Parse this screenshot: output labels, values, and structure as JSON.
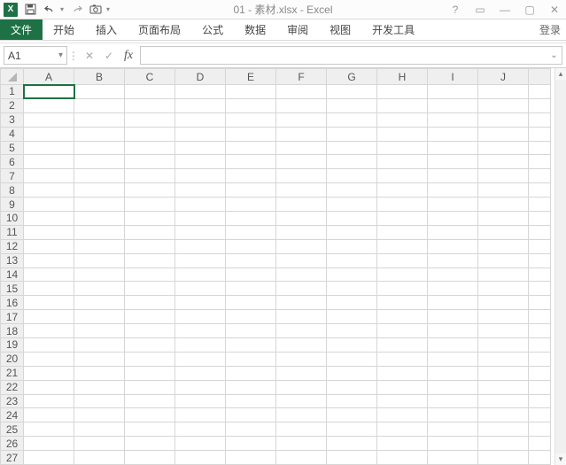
{
  "window": {
    "title": "01 - 素材.xlsx - Excel",
    "login_label": "登录"
  },
  "qat": {
    "undo_caret": "▾",
    "customize_caret": "▾"
  },
  "ribbon": {
    "tabs": [
      "文件",
      "开始",
      "插入",
      "页面布局",
      "公式",
      "数据",
      "审阅",
      "视图",
      "开发工具"
    ]
  },
  "formula_bar": {
    "name_box_value": "A1",
    "name_box_caret": "▾",
    "sep_char": "⋮",
    "cancel_char": "✕",
    "enter_char": "✓",
    "fx_char": "fx",
    "formula_value": "",
    "expand_char": "⌄"
  },
  "grid": {
    "columns": [
      "A",
      "B",
      "C",
      "D",
      "E",
      "F",
      "G",
      "H",
      "I",
      "J"
    ],
    "rows": [
      1,
      2,
      3,
      4,
      5,
      6,
      7,
      8,
      9,
      10,
      11,
      12,
      13,
      14,
      15,
      16,
      17,
      18,
      19,
      20,
      21,
      22,
      23,
      24,
      25,
      26,
      27
    ],
    "selected": {
      "row": 1,
      "col": "A"
    }
  },
  "window_controls": {
    "help": "?",
    "ribbon_opts": "▭",
    "minimize": "—",
    "restore": "▢",
    "close": "✕"
  },
  "colors": {
    "accent": "#1e7145",
    "grid_line": "#d6d6d6",
    "header_bg": "#efefef"
  }
}
